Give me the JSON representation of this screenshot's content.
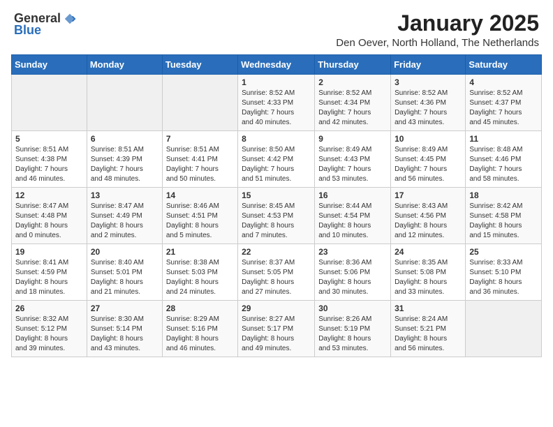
{
  "logo": {
    "general": "General",
    "blue": "Blue"
  },
  "title": "January 2025",
  "location": "Den Oever, North Holland, The Netherlands",
  "days_header": [
    "Sunday",
    "Monday",
    "Tuesday",
    "Wednesday",
    "Thursday",
    "Friday",
    "Saturday"
  ],
  "weeks": [
    [
      {
        "day": "",
        "content": ""
      },
      {
        "day": "",
        "content": ""
      },
      {
        "day": "",
        "content": ""
      },
      {
        "day": "1",
        "content": "Sunrise: 8:52 AM\nSunset: 4:33 PM\nDaylight: 7 hours\nand 40 minutes."
      },
      {
        "day": "2",
        "content": "Sunrise: 8:52 AM\nSunset: 4:34 PM\nDaylight: 7 hours\nand 42 minutes."
      },
      {
        "day": "3",
        "content": "Sunrise: 8:52 AM\nSunset: 4:36 PM\nDaylight: 7 hours\nand 43 minutes."
      },
      {
        "day": "4",
        "content": "Sunrise: 8:52 AM\nSunset: 4:37 PM\nDaylight: 7 hours\nand 45 minutes."
      }
    ],
    [
      {
        "day": "5",
        "content": "Sunrise: 8:51 AM\nSunset: 4:38 PM\nDaylight: 7 hours\nand 46 minutes."
      },
      {
        "day": "6",
        "content": "Sunrise: 8:51 AM\nSunset: 4:39 PM\nDaylight: 7 hours\nand 48 minutes."
      },
      {
        "day": "7",
        "content": "Sunrise: 8:51 AM\nSunset: 4:41 PM\nDaylight: 7 hours\nand 50 minutes."
      },
      {
        "day": "8",
        "content": "Sunrise: 8:50 AM\nSunset: 4:42 PM\nDaylight: 7 hours\nand 51 minutes."
      },
      {
        "day": "9",
        "content": "Sunrise: 8:49 AM\nSunset: 4:43 PM\nDaylight: 7 hours\nand 53 minutes."
      },
      {
        "day": "10",
        "content": "Sunrise: 8:49 AM\nSunset: 4:45 PM\nDaylight: 7 hours\nand 56 minutes."
      },
      {
        "day": "11",
        "content": "Sunrise: 8:48 AM\nSunset: 4:46 PM\nDaylight: 7 hours\nand 58 minutes."
      }
    ],
    [
      {
        "day": "12",
        "content": "Sunrise: 8:47 AM\nSunset: 4:48 PM\nDaylight: 8 hours\nand 0 minutes."
      },
      {
        "day": "13",
        "content": "Sunrise: 8:47 AM\nSunset: 4:49 PM\nDaylight: 8 hours\nand 2 minutes."
      },
      {
        "day": "14",
        "content": "Sunrise: 8:46 AM\nSunset: 4:51 PM\nDaylight: 8 hours\nand 5 minutes."
      },
      {
        "day": "15",
        "content": "Sunrise: 8:45 AM\nSunset: 4:53 PM\nDaylight: 8 hours\nand 7 minutes."
      },
      {
        "day": "16",
        "content": "Sunrise: 8:44 AM\nSunset: 4:54 PM\nDaylight: 8 hours\nand 10 minutes."
      },
      {
        "day": "17",
        "content": "Sunrise: 8:43 AM\nSunset: 4:56 PM\nDaylight: 8 hours\nand 12 minutes."
      },
      {
        "day": "18",
        "content": "Sunrise: 8:42 AM\nSunset: 4:58 PM\nDaylight: 8 hours\nand 15 minutes."
      }
    ],
    [
      {
        "day": "19",
        "content": "Sunrise: 8:41 AM\nSunset: 4:59 PM\nDaylight: 8 hours\nand 18 minutes."
      },
      {
        "day": "20",
        "content": "Sunrise: 8:40 AM\nSunset: 5:01 PM\nDaylight: 8 hours\nand 21 minutes."
      },
      {
        "day": "21",
        "content": "Sunrise: 8:38 AM\nSunset: 5:03 PM\nDaylight: 8 hours\nand 24 minutes."
      },
      {
        "day": "22",
        "content": "Sunrise: 8:37 AM\nSunset: 5:05 PM\nDaylight: 8 hours\nand 27 minutes."
      },
      {
        "day": "23",
        "content": "Sunrise: 8:36 AM\nSunset: 5:06 PM\nDaylight: 8 hours\nand 30 minutes."
      },
      {
        "day": "24",
        "content": "Sunrise: 8:35 AM\nSunset: 5:08 PM\nDaylight: 8 hours\nand 33 minutes."
      },
      {
        "day": "25",
        "content": "Sunrise: 8:33 AM\nSunset: 5:10 PM\nDaylight: 8 hours\nand 36 minutes."
      }
    ],
    [
      {
        "day": "26",
        "content": "Sunrise: 8:32 AM\nSunset: 5:12 PM\nDaylight: 8 hours\nand 39 minutes."
      },
      {
        "day": "27",
        "content": "Sunrise: 8:30 AM\nSunset: 5:14 PM\nDaylight: 8 hours\nand 43 minutes."
      },
      {
        "day": "28",
        "content": "Sunrise: 8:29 AM\nSunset: 5:16 PM\nDaylight: 8 hours\nand 46 minutes."
      },
      {
        "day": "29",
        "content": "Sunrise: 8:27 AM\nSunset: 5:17 PM\nDaylight: 8 hours\nand 49 minutes."
      },
      {
        "day": "30",
        "content": "Sunrise: 8:26 AM\nSunset: 5:19 PM\nDaylight: 8 hours\nand 53 minutes."
      },
      {
        "day": "31",
        "content": "Sunrise: 8:24 AM\nSunset: 5:21 PM\nDaylight: 8 hours\nand 56 minutes."
      },
      {
        "day": "",
        "content": ""
      }
    ]
  ]
}
